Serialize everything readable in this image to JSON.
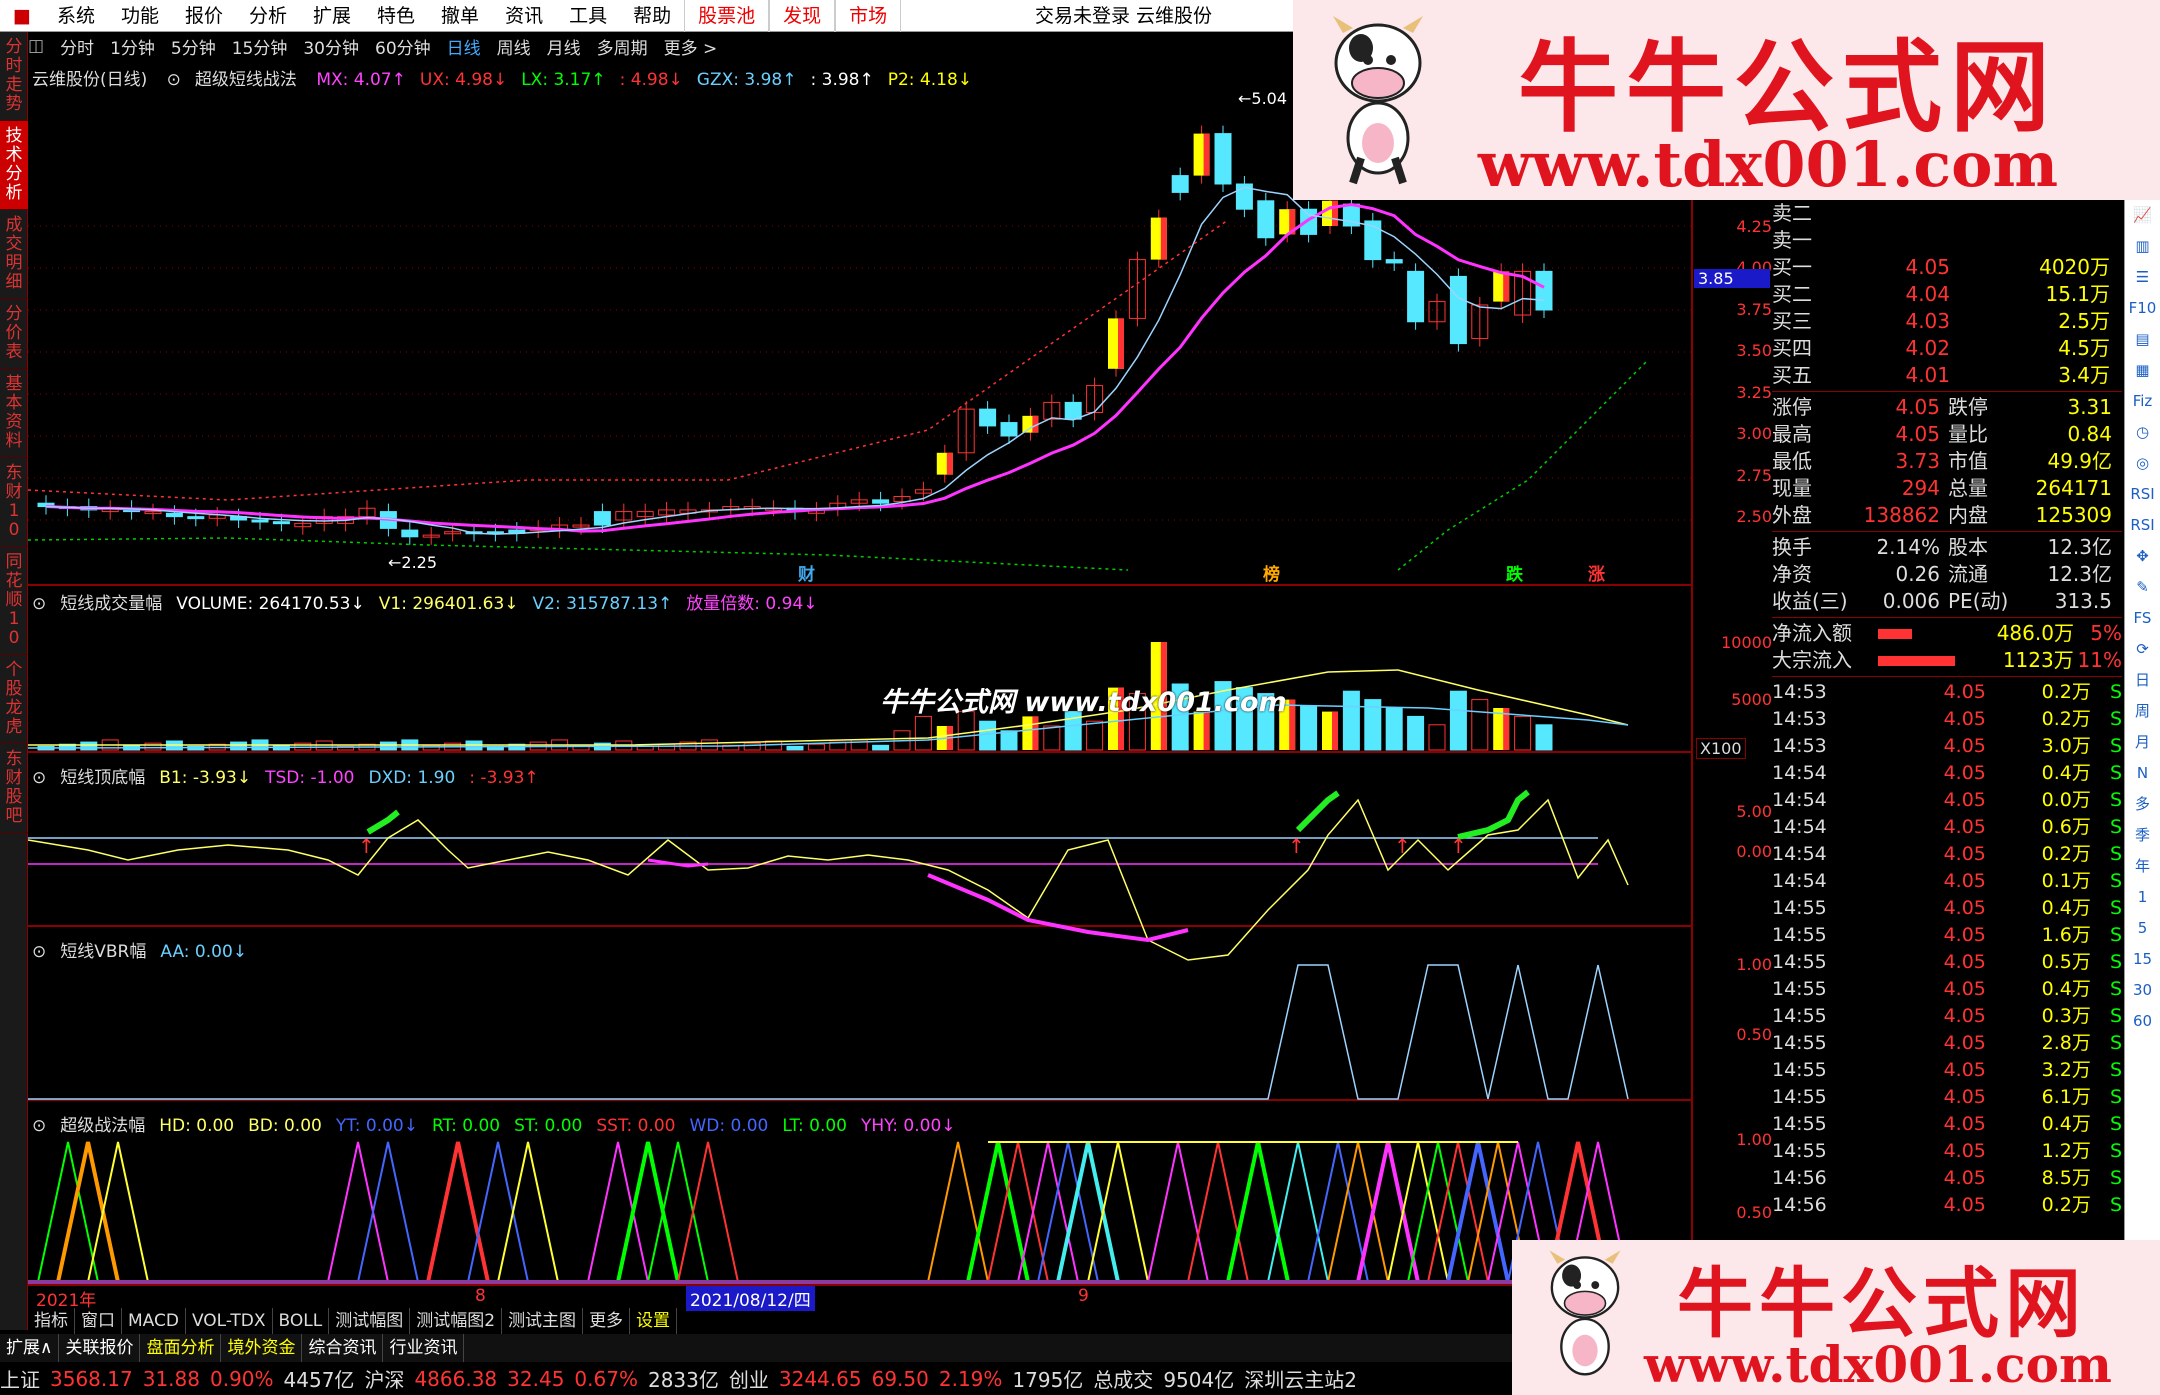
{
  "menu": {
    "items": [
      "系统",
      "功能",
      "报价",
      "分析",
      "扩展",
      "特色",
      "撤单",
      "资讯",
      "工具",
      "帮助"
    ],
    "red_items": [
      "股票池",
      "发现",
      "市场"
    ],
    "title": "交易未登录  云维股份"
  },
  "left_tabs": [
    "分时走势",
    "技术分析",
    "成交明细",
    "分价表",
    "基本资料",
    "东财10",
    "同花顺10",
    "个股龙虎",
    "东财股吧"
  ],
  "period_tabs": [
    "分时",
    "1分钟",
    "5分钟",
    "15分钟",
    "30分钟",
    "60分钟",
    "日线",
    "周线",
    "月线",
    "多周期",
    "更多 >"
  ],
  "main_panel": {
    "stock": "云维股份(日线)",
    "indicator": "超级短线战法",
    "params": [
      {
        "t": "MX: 4.07↑",
        "c": "#ff44ff"
      },
      {
        "t": "UX: 4.98↓",
        "c": "#ff3333"
      },
      {
        "t": "LX: 3.17↑",
        "c": "#00ff00"
      },
      {
        "t": ": 4.98↓",
        "c": "#ff3333"
      },
      {
        "t": "GZX: 3.98↑",
        "c": "#6ad0ff"
      },
      {
        "t": ": 3.98↑",
        "c": "#ffffff"
      },
      {
        "t": "P2: 4.18↓",
        "c": "#ffff00"
      }
    ],
    "axis": [
      "4.25",
      "4.00",
      "3.75",
      "3.50",
      "3.25",
      "3.00",
      "2.75",
      "2.50"
    ],
    "current_price_tag": "3.85",
    "high_label": "5.04",
    "low_label": "2.25",
    "markers": [
      {
        "t": "财",
        "c": "#4ae"
      },
      {
        "t": "榜",
        "c": "#fa0"
      },
      {
        "t": "跌",
        "c": "#0f0"
      },
      {
        "t": "涨",
        "c": "#f33"
      }
    ]
  },
  "volume_panel": {
    "title": "短线成交量幅",
    "params": [
      {
        "t": "VOLUME: 264170.53↓",
        "c": "#ffffff"
      },
      {
        "t": "V1: 296401.63↓",
        "c": "#ffff66"
      },
      {
        "t": "V2: 315787.13↑",
        "c": "#6ad0ff"
      },
      {
        "t": "放量倍数: 0.94↓",
        "c": "#ff44ff"
      }
    ],
    "axis": [
      "10000",
      "5000"
    ],
    "unit": "X100"
  },
  "topbottom_panel": {
    "title": "短线顶底幅",
    "params": [
      {
        "t": "B1: -3.93↓",
        "c": "#ffff66"
      },
      {
        "t": "TSD: -1.00",
        "c": "#ff44ff"
      },
      {
        "t": "DXD: 1.90",
        "c": "#6ad0ff"
      },
      {
        "t": ": -3.93↑",
        "c": "#ff3333"
      }
    ],
    "axis": [
      "5.00",
      "0.00"
    ]
  },
  "vbr_panel": {
    "title": "短线VBR幅",
    "params": [
      {
        "t": "AA: 0.00↓",
        "c": "#6ad0ff"
      }
    ],
    "axis": [
      "1.00",
      "0.50"
    ]
  },
  "super_panel": {
    "title": "超级战法幅",
    "params": [
      {
        "t": "HD: 0.00",
        "c": "#ffff66"
      },
      {
        "t": "BD: 0.00",
        "c": "#ffff66"
      },
      {
        "t": "YT: 0.00↓",
        "c": "#4466ff"
      },
      {
        "t": "RT: 0.00",
        "c": "#00ff00"
      },
      {
        "t": "ST: 0.00",
        "c": "#00ff00"
      },
      {
        "t": "SST: 0.00",
        "c": "#ff3333"
      },
      {
        "t": "WD: 0.00",
        "c": "#4466ff"
      },
      {
        "t": "LT: 0.00",
        "c": "#00ff00"
      },
      {
        "t": "YHY: 0.00↓",
        "c": "#ff44ff"
      }
    ],
    "axis": [
      "1.00",
      "0.50"
    ]
  },
  "date_axis": {
    "year": "2021年",
    "m8": "8",
    "cursor": "2021/08/12/四",
    "m9": "9"
  },
  "bottom_tabs": [
    "指标",
    "窗口",
    "MACD",
    "VOL-TDX",
    "BOLL",
    "测试幅图",
    "测试幅图2",
    "测试主图",
    "更多",
    "设置"
  ],
  "bottom_tabs2": [
    "扩展∧",
    "关联报价",
    "盘面分析",
    "境外资金",
    "综合资讯",
    "行业资讯"
  ],
  "quote": {
    "ask_rows": [
      "卖二",
      "卖一"
    ],
    "bids": [
      [
        "买一",
        "4.05",
        "4020万"
      ],
      [
        "买二",
        "4.04",
        "15.1万"
      ],
      [
        "买三",
        "4.03",
        "2.5万"
      ],
      [
        "买四",
        "4.02",
        "4.5万"
      ],
      [
        "买五",
        "4.01",
        "3.4万"
      ]
    ],
    "stats": [
      [
        "涨停",
        "4.05",
        "跌停",
        "3.31"
      ],
      [
        "最高",
        "4.05",
        "量比",
        "0.84"
      ],
      [
        "最低",
        "3.73",
        "市值",
        "49.9亿"
      ],
      [
        "现量",
        "294",
        "总量",
        "264171"
      ],
      [
        "外盘",
        "138862",
        "内盘",
        "125309"
      ]
    ],
    "stats2": [
      [
        "换手",
        "2.14%",
        "股本",
        "12.3亿"
      ],
      [
        "净资",
        "0.26",
        "流通",
        "12.3亿"
      ],
      [
        "收益(三)",
        "0.006",
        "PE(动)",
        "313.5"
      ]
    ],
    "flows": [
      [
        "净流入额",
        "486.0万",
        "5%"
      ],
      [
        "大宗流入",
        "1123万",
        "11%"
      ]
    ],
    "ticks": [
      [
        "14:53",
        "4.05",
        "0.2万",
        "S"
      ],
      [
        "14:53",
        "4.05",
        "0.2万",
        "S"
      ],
      [
        "14:53",
        "4.05",
        "3.0万",
        "S"
      ],
      [
        "14:54",
        "4.05",
        "0.4万",
        "S"
      ],
      [
        "14:54",
        "4.05",
        "0.0万",
        "S"
      ],
      [
        "14:54",
        "4.05",
        "0.6万",
        "S"
      ],
      [
        "14:54",
        "4.05",
        "0.2万",
        "S"
      ],
      [
        "14:54",
        "4.05",
        "0.1万",
        "S"
      ],
      [
        "14:55",
        "4.05",
        "0.4万",
        "S"
      ],
      [
        "14:55",
        "4.05",
        "1.6万",
        "S"
      ],
      [
        "14:55",
        "4.05",
        "0.5万",
        "S"
      ],
      [
        "14:55",
        "4.05",
        "0.4万",
        "S"
      ],
      [
        "14:55",
        "4.05",
        "0.3万",
        "S"
      ],
      [
        "14:55",
        "4.05",
        "2.8万",
        "S"
      ],
      [
        "14:55",
        "4.05",
        "3.2万",
        "S"
      ],
      [
        "14:55",
        "4.05",
        "6.1万",
        "S"
      ],
      [
        "14:55",
        "4.05",
        "0.4万",
        "S"
      ],
      [
        "14:55",
        "4.05",
        "1.2万",
        "S"
      ],
      [
        "14:56",
        "4.05",
        "8.5万",
        "S"
      ],
      [
        "14:56",
        "4.05",
        "0.2万",
        "S"
      ]
    ]
  },
  "right_icons": [
    "日",
    "周",
    "月",
    "N",
    "多",
    "季",
    "年",
    "1",
    "5",
    "15",
    "30",
    "60"
  ],
  "status": {
    "sh_label": "上证",
    "sh": "3568.17",
    "sh_chg": "31.88",
    "sh_pct": "0.90%",
    "sh_amt": "4457亿",
    "sz_label": "沪深",
    "sz": "4866.38",
    "sz_chg": "32.45",
    "sz_pct": "0.67%",
    "sz_amt": "2833亿",
    "cy_label": "创业",
    "cy": "3244.65",
    "cy_chg": "69.50",
    "cy_pct": "2.19%",
    "cy_amt": "1795亿",
    "total_label": "总成交",
    "total": "9504亿",
    "server": "深圳云主站2"
  },
  "watermark": {
    "cn": "牛牛公式网",
    "url": "www.tdx001.com",
    "mid": "牛牛公式网 www.tdx001.com"
  }
}
